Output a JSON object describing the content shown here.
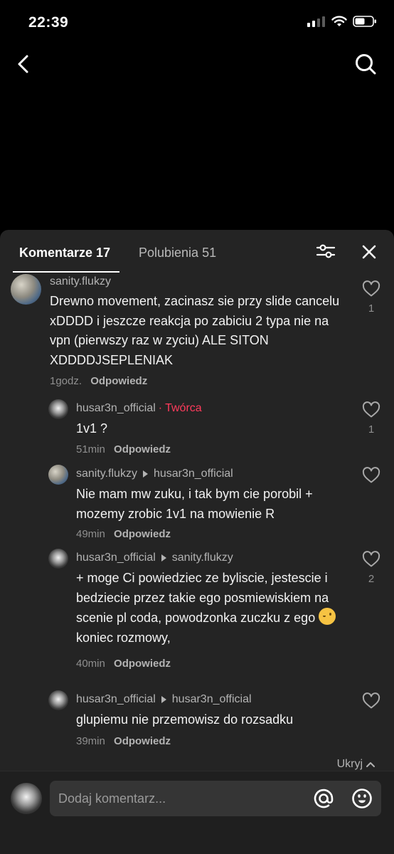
{
  "status_bar": {
    "time": "22:39"
  },
  "tabs": {
    "comments": "Komentarze 17",
    "likes": "Polubienia 51"
  },
  "comments": [
    {
      "author": "sanity.flukzy",
      "text": "Drewno movement, zacinasz sie przy slide cancelu xDDDD i jeszcze reakcja po zabiciu 2 typa nie na vpn (pierwszy raz w zyciu) ALE SITON XDDDDJSEPLENIAK",
      "time": "1godz.",
      "reply_label": "Odpowiedz",
      "likes": "1"
    },
    {
      "author": "husar3n_official",
      "separator": "·",
      "badge": "Twórca",
      "text": "1v1 ?",
      "time": "51min",
      "reply_label": "Odpowiedz",
      "likes": "1"
    },
    {
      "author": "sanity.flukzy",
      "reply_to": "husar3n_official",
      "text": "Nie mam mw zuku, i tak bym cie porobil + mozemy zrobic 1v1 na mowienie R",
      "time": "49min",
      "reply_label": "Odpowiedz",
      "likes": ""
    },
    {
      "author": "husar3n_official",
      "reply_to": "sanity.flukzy",
      "text_before_emoji": "+ moge Ci powiedziec ze byliscie, jestescie i bedziecie przez takie ego posmiewiskiem na scenie pl coda, powodzonka zuczku z ego",
      "text_after_emoji": "koniec rozmowy,",
      "emoji": "winking-face",
      "time": "40min",
      "reply_label": "Odpowiedz",
      "likes": "2"
    },
    {
      "author": "husar3n_official",
      "reply_to": "husar3n_official",
      "text": "glupiemu nie przemowisz do rozsadku",
      "time": "39min",
      "reply_label": "Odpowiedz",
      "likes": ""
    }
  ],
  "hide_label": "Ukryj",
  "composer": {
    "placeholder": "Dodaj komentarz..."
  },
  "colors": {
    "accent_creator": "#ff3b5c",
    "sheet_bg": "#242424"
  }
}
